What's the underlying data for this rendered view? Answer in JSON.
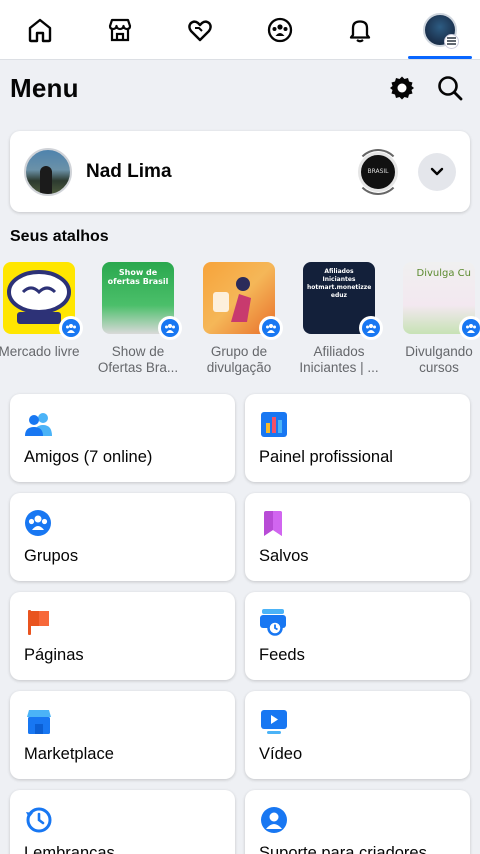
{
  "nav": {
    "tabs": [
      {
        "name": "home",
        "icon": "home-icon"
      },
      {
        "name": "marketplace",
        "icon": "store-icon"
      },
      {
        "name": "dating",
        "icon": "heart-icon"
      },
      {
        "name": "groups",
        "icon": "groups-icon"
      },
      {
        "name": "notifications",
        "icon": "bell-icon"
      },
      {
        "name": "menu",
        "icon": "profile-avatar-icon",
        "active": true
      }
    ],
    "accent": "#0866ff"
  },
  "header": {
    "title": "Menu"
  },
  "profile": {
    "name": "Nad Lima",
    "page_badge_text": "BRASIL"
  },
  "shortcuts": {
    "title": "Seus atalhos",
    "items": [
      {
        "label": "Mercado livre",
        "thumb_text": "mercado livre"
      },
      {
        "label": "Show de Ofertas Bra...",
        "thumb_text": "Show de ofertas Brasil"
      },
      {
        "label": "Grupo de divulgação",
        "thumb_text": ""
      },
      {
        "label": "Afiliados Iniciantes | ...",
        "thumb_text": "Afiliados Iniciantes hotmart.monetizze eduz"
      },
      {
        "label": "Divulgando cursos",
        "thumb_text": "Divulga Cu"
      }
    ]
  },
  "menu_cards": [
    {
      "label": "Amigos (7 online)",
      "icon": "friends-icon"
    },
    {
      "label": "Painel profissional",
      "icon": "dashboard-icon"
    },
    {
      "label": "Grupos",
      "icon": "groups-icon"
    },
    {
      "label": "Salvos",
      "icon": "bookmark-icon"
    },
    {
      "label": "Páginas",
      "icon": "flag-icon"
    },
    {
      "label": "Feeds",
      "icon": "feeds-icon"
    },
    {
      "label": "Marketplace",
      "icon": "marketplace-icon"
    },
    {
      "label": "Vídeo",
      "icon": "video-icon"
    },
    {
      "label": "Lembranças",
      "icon": "memories-icon"
    },
    {
      "label": "Suporte para criadores",
      "icon": "creator-support-icon"
    }
  ]
}
